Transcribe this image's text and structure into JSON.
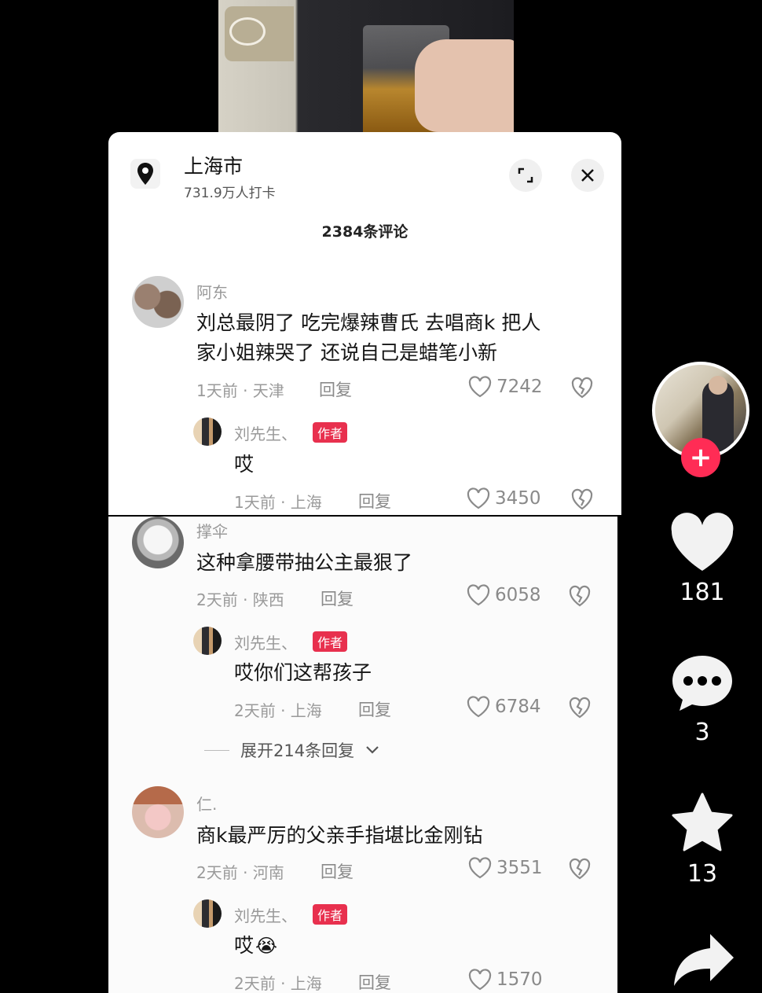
{
  "location": {
    "title": "上海市",
    "subtitle": "731.9万人打卡"
  },
  "comments_header": "2384条评论",
  "comments": [
    {
      "username": "阿东",
      "text_line1": "刘总最阴了  吃完爆辣曹氏  去唱商k  把人",
      "text_line2": "家小姐辣哭了  还说自己是蜡笔小新",
      "time_place": "1天前 · 天津",
      "reply_label": "回复",
      "likes": "7242",
      "reply": {
        "username": "刘先生、",
        "badge": "作者",
        "text": "哎",
        "time_place": "1天前 · 上海",
        "reply_label": "回复",
        "likes": "3450"
      }
    },
    {
      "username": "撑伞",
      "text": "这种拿腰带抽公主最狠了",
      "time_place": "2天前 · 陕西",
      "reply_label": "回复",
      "likes": "6058",
      "reply": {
        "username": "刘先生、",
        "badge": "作者",
        "text": "哎你们这帮孩子",
        "time_place": "2天前 · 上海",
        "reply_label": "回复",
        "likes": "6784"
      },
      "expand_label": "展开214条回复"
    },
    {
      "username": "仁.",
      "text": "商k最严厉的父亲手指堪比金刚钻",
      "time_place": "2天前 · 河南",
      "reply_label": "回复",
      "likes": "3551",
      "reply": {
        "username": "刘先生、",
        "badge": "作者",
        "text": "哎",
        "emoji": "😭",
        "time_place": "2天前 · 上海",
        "reply_label": "回复",
        "likes": "1570"
      }
    }
  ],
  "rail": {
    "likes": "181",
    "comments": "3",
    "favorites": "13"
  },
  "icons": {
    "location": "location-pin-icon",
    "expand": "expand-icon",
    "close": "close-icon",
    "like": "heart-outline-icon",
    "dislike": "broken-heart-icon",
    "rail_like": "heart-icon",
    "rail_comment": "chat-bubble-icon",
    "rail_favorite": "star-icon",
    "rail_share": "share-arrow-icon",
    "follow": "plus-icon"
  },
  "colors": {
    "accent": "#ff2c55",
    "badge": "#e8304e"
  }
}
